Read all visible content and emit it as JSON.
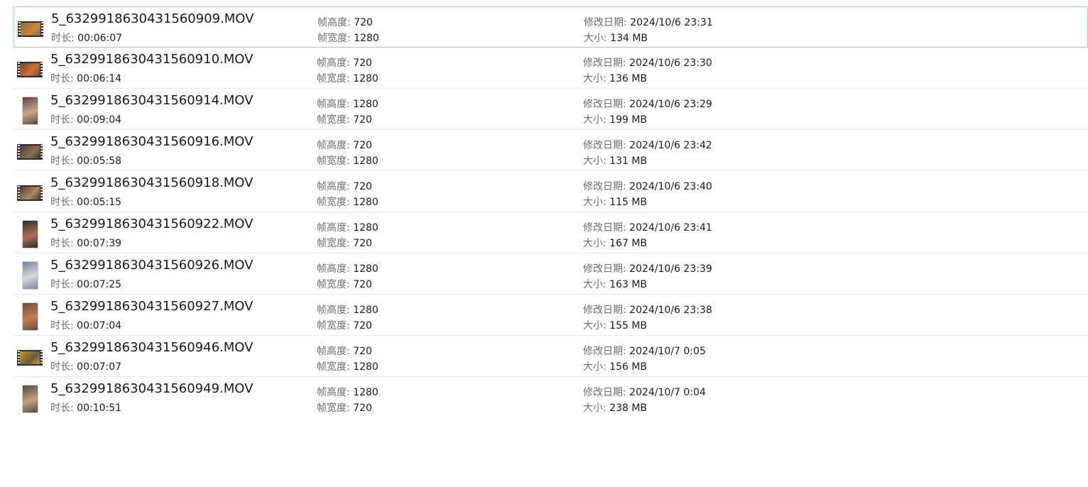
{
  "labels": {
    "duration": "时长:",
    "frame_height": "帧高度:",
    "frame_width": "帧宽度:",
    "modified": "修改日期:",
    "size": "大小:"
  },
  "files": [
    {
      "name": "5_6329918630431560909.MOV",
      "duration": "00:06:07",
      "frame_height": "720",
      "frame_width": "1280",
      "modified": "2024/10/6 23:31",
      "size": "134 MB",
      "thumb": "landscape",
      "thumb_colors": [
        "#8a6a4a",
        "#c98a3a"
      ],
      "selected": true
    },
    {
      "name": "5_6329918630431560910.MOV",
      "duration": "00:06:14",
      "frame_height": "720",
      "frame_width": "1280",
      "modified": "2024/10/6 23:30",
      "size": "136 MB",
      "thumb": "landscape",
      "thumb_colors": [
        "#6b4a35",
        "#d07030"
      ],
      "selected": false
    },
    {
      "name": "5_6329918630431560914.MOV",
      "duration": "00:09:04",
      "frame_height": "1280",
      "frame_width": "720",
      "modified": "2024/10/6 23:29",
      "size": "199 MB",
      "thumb": "portrait",
      "thumb_colors": [
        "#5a4538",
        "#c8a590"
      ],
      "selected": false
    },
    {
      "name": "5_6329918630431560916.MOV",
      "duration": "00:05:58",
      "frame_height": "720",
      "frame_width": "1280",
      "modified": "2024/10/6 23:42",
      "size": "131 MB",
      "thumb": "landscape",
      "thumb_colors": [
        "#3a3a3a",
        "#8a7050"
      ],
      "selected": false
    },
    {
      "name": "5_6329918630431560918.MOV",
      "duration": "00:05:15",
      "frame_height": "720",
      "frame_width": "1280",
      "modified": "2024/10/6 23:40",
      "size": "115 MB",
      "thumb": "landscape",
      "thumb_colors": [
        "#4a3a30",
        "#b08860"
      ],
      "selected": false
    },
    {
      "name": "5_6329918630431560922.MOV",
      "duration": "00:07:39",
      "frame_height": "1280",
      "frame_width": "720",
      "modified": "2024/10/6 23:41",
      "size": "167 MB",
      "thumb": "portrait",
      "thumb_colors": [
        "#2a2a2a",
        "#b07050"
      ],
      "selected": false
    },
    {
      "name": "5_6329918630431560926.MOV",
      "duration": "00:07:25",
      "frame_height": "1280",
      "frame_width": "720",
      "modified": "2024/10/6 23:39",
      "size": "163 MB",
      "thumb": "portrait",
      "thumb_colors": [
        "#7088a0",
        "#d8d8d8"
      ],
      "selected": false
    },
    {
      "name": "5_6329918630431560927.MOV",
      "duration": "00:07:04",
      "frame_height": "1280",
      "frame_width": "720",
      "modified": "2024/10/6 23:38",
      "size": "155 MB",
      "thumb": "portrait",
      "thumb_colors": [
        "#6a4a3a",
        "#c08050"
      ],
      "selected": false
    },
    {
      "name": "5_6329918630431560946.MOV",
      "duration": "00:07:07",
      "frame_height": "720",
      "frame_width": "1280",
      "modified": "2024/10/7 0:05",
      "size": "156 MB",
      "thumb": "landscape",
      "thumb_colors": [
        "#c8a020",
        "#6a5a40"
      ],
      "selected": false
    },
    {
      "name": "5_6329918630431560949.MOV",
      "duration": "00:10:51",
      "frame_height": "1280",
      "frame_width": "720",
      "modified": "2024/10/7 0:04",
      "size": "238 MB",
      "thumb": "portrait",
      "thumb_colors": [
        "#5a4a40",
        "#c0a080"
      ],
      "selected": false
    }
  ]
}
